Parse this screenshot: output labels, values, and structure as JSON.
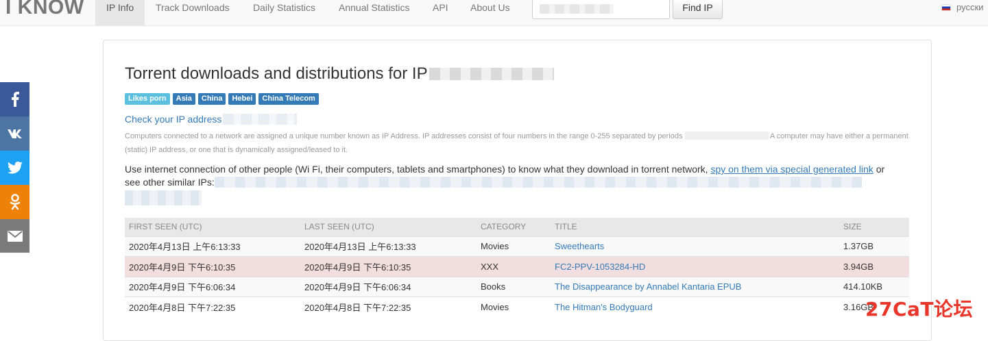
{
  "navbar": {
    "brand": "I KNOW",
    "items": [
      {
        "label": "IP Info",
        "active": true
      },
      {
        "label": "Track Downloads"
      },
      {
        "label": "Daily Statistics"
      },
      {
        "label": "Annual Statistics"
      },
      {
        "label": "API"
      },
      {
        "label": "About Us"
      }
    ],
    "find_button": "Find IP",
    "language": "русски"
  },
  "social": [
    "facebook-icon",
    "vk-icon",
    "twitter-icon",
    "odnoklassniki-icon",
    "email-icon"
  ],
  "main": {
    "title": "Torrent downloads and distributions for IP",
    "badges": [
      {
        "label": "Likes porn",
        "style": "info"
      },
      {
        "label": "Asia",
        "style": "primary"
      },
      {
        "label": "China",
        "style": "primary"
      },
      {
        "label": "Hebei",
        "style": "primary"
      },
      {
        "label": "China Telecom",
        "style": "primary"
      }
    ],
    "check_link": "Check your IP address",
    "desc_part1": "Computers connected to a network are assigned a unique number known as IP Address. IP addresses consist of four numbers in the range 0-255 separated by periods",
    "desc_part2": "A computer may have either a permanent (static) IP address, or one that is dynamically assigned/leased to it.",
    "spy_text": "Use internet connection of other people (Wi Fi, their computers, tablets and smartphones) to know what they download in torrent network,",
    "spy_link": "spy on them via special generated link",
    "spy_or": "or",
    "similar_label": "see other similar IPs:"
  },
  "table": {
    "headers": [
      "FIRST SEEN (UTC)",
      "LAST SEEN (UTC)",
      "CATEGORY",
      "TITLE",
      "SIZE"
    ],
    "rows": [
      {
        "first": "2020年4月13日 上午6:13:33",
        "last": "2020年4月13日 上午6:13:33",
        "category": "Movies",
        "title": "Sweethearts",
        "size": "1.37GB"
      },
      {
        "first": "2020年4月9日 下午6:10:35",
        "last": "2020年4月9日 下午6:10:35",
        "category": "XXX",
        "title": "FC2-PPV-1053284-HD",
        "size": "3.94GB"
      },
      {
        "first": "2020年4月9日 下午6:06:34",
        "last": "2020年4月9日 下午6:06:34",
        "category": "Books",
        "title": "The Disappearance by Annabel Kantaria EPUB",
        "size": "414.10KB"
      },
      {
        "first": "2020年4月8日 下午7:22:35",
        "last": "2020年4月8日 下午7:22:35",
        "category": "Movies",
        "title": "The Hitman's Bodyguard",
        "size": "3.16GB"
      }
    ]
  },
  "watermark": "27CaT论坛"
}
